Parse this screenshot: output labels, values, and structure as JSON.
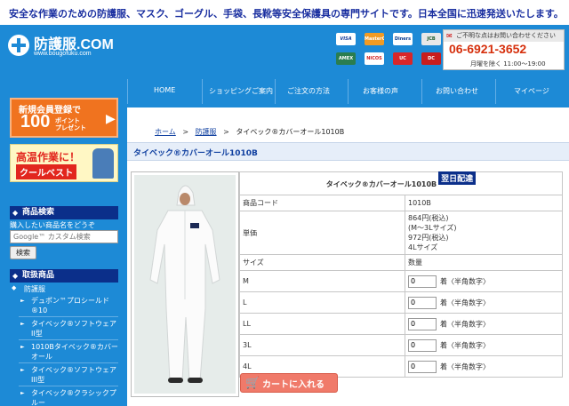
{
  "announcement": "安全な作業のための防護服、マスク、ゴーグル、手袋、長靴等安全保護具の専門サイトです。日本全国に迅速発送いたします。",
  "logo": {
    "name": "防護服.COM",
    "url": "www.bougofuku.com"
  },
  "payments": [
    "VISA",
    "MasterCard",
    "Diners",
    "JCB",
    "AMEX",
    "NICOS",
    "UC",
    "DC"
  ],
  "contact": {
    "heading": "ご不明な点はお問い合わせください",
    "tel": "06-6921-3652",
    "hours": "月曜を除く 11:00～19:00"
  },
  "nav": {
    "items": [
      "HOME",
      "ショッピングご案内",
      "ご注文の方法",
      "お客様の声",
      "お問い合わせ",
      "マイページ"
    ]
  },
  "banners": {
    "member": {
      "line1": "新規会員登録で",
      "points": "100",
      "line3": "ポイント プレゼント"
    },
    "cool": {
      "line1": "高温作業に！",
      "line2": "クールベスト"
    }
  },
  "sidebar": {
    "search_heading": "商品検索",
    "search_text": "購入したい商品名をどうぞ",
    "search_placeholder": "Google™ カスタム検索",
    "search_button": "検索",
    "products_heading": "取扱商品",
    "top_category": "防護服",
    "categories": [
      "デュポン™プロシールド®10",
      "タイベック®ソフトウェアII型",
      "1010Bタイベック®カバーオール",
      "タイベック®ソフトウェアIII型",
      "タイベック®クラシックプ ルー"
    ]
  },
  "breadcrumb": {
    "home": "ホーム",
    "category": "防護服",
    "current": "タイベック®カバーオール1010B"
  },
  "product": {
    "page_title": "タイベック®カバーオール1010B",
    "name": "タイベック®カバーオール1010B",
    "badge": "翌日配達",
    "code_label": "商品コード",
    "code_value": "1010B",
    "price_label": "単価",
    "price_lines": [
      "864円(税込)",
      "(M～3Lサイズ)",
      "972円(税込)",
      "4Lサイズ"
    ],
    "size_header": "サイズ",
    "qty_header": "数量",
    "unit_note": "着〈半角数字〉",
    "sizes": [
      {
        "size": "M",
        "qty": "0"
      },
      {
        "size": "L",
        "qty": "0"
      },
      {
        "size": "LL",
        "qty": "0"
      },
      {
        "size": "3L",
        "qty": "0"
      },
      {
        "size": "4L",
        "qty": "0"
      }
    ],
    "cart_button": "カートに入れる"
  },
  "colors": {
    "brand_blue": "#1d8ad6",
    "navy": "#0b2f8a",
    "orange": "#f0731f",
    "red_tel": "#d6300d"
  }
}
